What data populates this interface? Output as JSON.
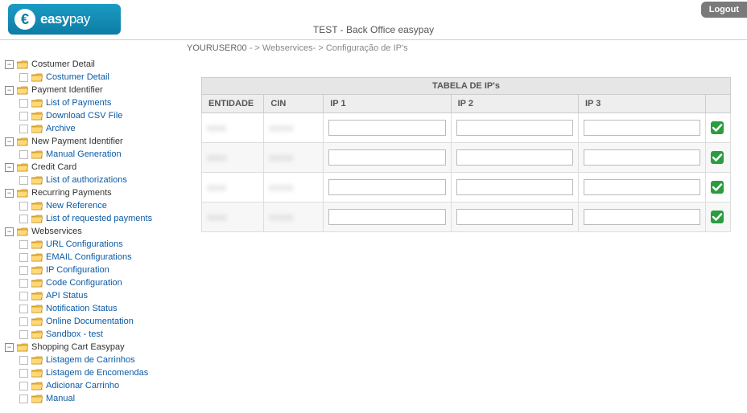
{
  "header": {
    "logo_text_bold": "easy",
    "logo_text_light": "pay",
    "title": "TEST - Back Office easypay",
    "logout_label": "Logout"
  },
  "breadcrumb": {
    "user": "YOURUSER00",
    "sep1": " - > ",
    "part1": "Webservices",
    "sep2": "- > ",
    "part2": "Configuração de IP's"
  },
  "sidebar": {
    "groups": [
      {
        "label": "Costumer Detail",
        "items": [
          {
            "label": "Costumer Detail"
          }
        ]
      },
      {
        "label": "Payment Identifier",
        "items": [
          {
            "label": "List of Payments"
          },
          {
            "label": "Download CSV File"
          },
          {
            "label": "Archive"
          }
        ]
      },
      {
        "label": "New Payment Identifier",
        "items": [
          {
            "label": "Manual Generation"
          }
        ]
      },
      {
        "label": "Credit Card",
        "items": [
          {
            "label": "List of authorizations"
          }
        ]
      },
      {
        "label": "Recurring Payments",
        "items": [
          {
            "label": "New Reference"
          },
          {
            "label": "List of requested payments"
          }
        ]
      },
      {
        "label": "Webservices",
        "items": [
          {
            "label": "URL Configurations"
          },
          {
            "label": "EMAIL Configurations"
          },
          {
            "label": "IP Configuration"
          },
          {
            "label": "Code Configuration"
          },
          {
            "label": "API Status"
          },
          {
            "label": "Notification Status"
          },
          {
            "label": "Online Documentation"
          },
          {
            "label": "Sandbox - test"
          }
        ]
      },
      {
        "label": "Shopping Cart Easypay",
        "items": [
          {
            "label": "Listagem de Carrinhos"
          },
          {
            "label": "Listagem de Encomendas"
          },
          {
            "label": "Adicionar Carrinho"
          },
          {
            "label": "Manual"
          }
        ]
      }
    ]
  },
  "table": {
    "caption": "TABELA DE IP's",
    "headers": {
      "entidade": "ENTIDADE",
      "cin": "CIN",
      "ip1": "IP 1",
      "ip2": "IP 2",
      "ip3": "IP 3"
    },
    "rows": [
      {
        "entidade": "—",
        "cin": "—",
        "ip1": "",
        "ip2": "",
        "ip3": ""
      },
      {
        "entidade": "—",
        "cin": "—",
        "ip1": "",
        "ip2": "",
        "ip3": ""
      },
      {
        "entidade": "—",
        "cin": "—",
        "ip1": "",
        "ip2": "",
        "ip3": ""
      },
      {
        "entidade": "—",
        "cin": "—",
        "ip1": "",
        "ip2": "",
        "ip3": ""
      }
    ]
  }
}
